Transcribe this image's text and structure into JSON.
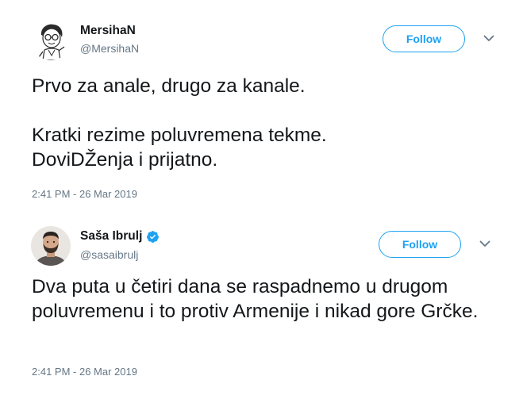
{
  "tweets": [
    {
      "display_name": "MersihaN",
      "handle": "@MersihaN",
      "follow_label": "Follow",
      "text": "Prvo za anale, drugo za kanale.\n\nKratki rezime poluvremena tekme.\nDoviDŽenja i prijatno.",
      "timestamp": "2:41 PM - 26 Mar 2019",
      "verified": false,
      "avatar_icon": "cartoon-portrait"
    },
    {
      "display_name": "Saša Ibrulj",
      "handle": "@sasaibrulj",
      "follow_label": "Follow",
      "text": "Dva puta u četiri dana se raspadnemo u drugom poluvremenu i to protiv Armenije i nikad gore Grčke.",
      "timestamp": "2:41 PM - 26 Mar 2019",
      "verified": true,
      "avatar_icon": "photo-portrait"
    }
  ],
  "colors": {
    "accent": "#1da1f2",
    "text": "#14171a",
    "secondary": "#657786",
    "chevron": "#657786"
  }
}
